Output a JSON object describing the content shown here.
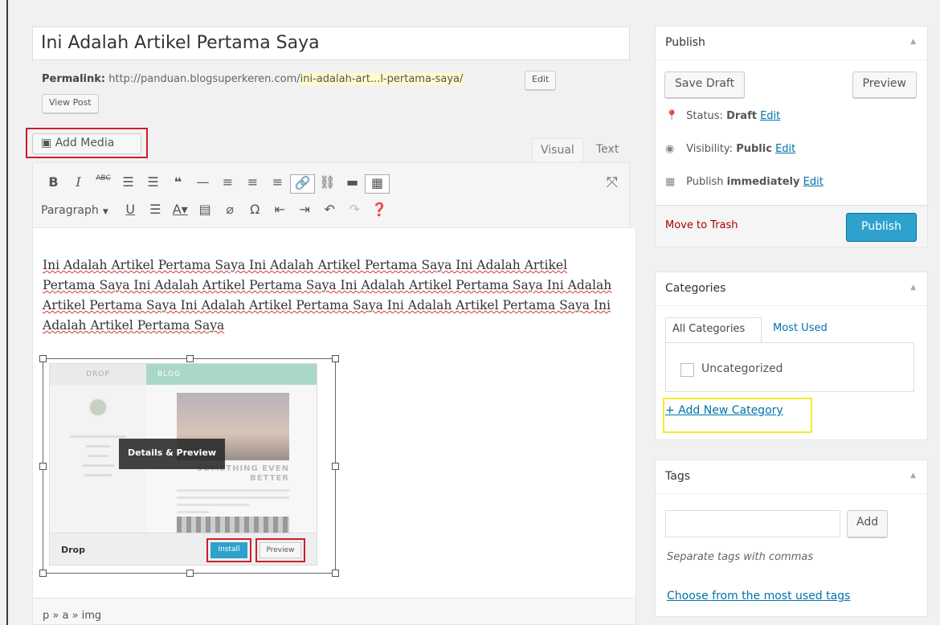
{
  "post": {
    "title": "Ini Adalah Artikel Pertama Saya",
    "permalink_label": "Permalink:",
    "permalink_base": "http://panduan.blogsuperkeren.com/",
    "permalink_slug": "ini-adalah-art...l-pertama-saya/",
    "edit_label": "Edit",
    "view_post_label": "View Post",
    "content": "Ini Adalah Artikel Pertama Saya Ini Adalah Artikel Pertama Saya Ini Adalah Artikel Pertama Saya Ini Adalah Artikel Pertama Saya Ini Adalah Artikel Pertama Saya Ini Adalah Artikel Pertama Saya Ini Adalah Artikel Pertama Saya Ini Adalah Artikel Pertama Saya Ini Adalah Artikel Pertama Saya"
  },
  "editor": {
    "add_media_label": "Add Media",
    "tab_visual": "Visual",
    "tab_text": "Text",
    "format_select": "Paragraph",
    "path": "p » a » img"
  },
  "embedded_image": {
    "header_left": "DROP",
    "header_right": "BLOG",
    "overlay": "Details & Preview",
    "headline": "SOMETHING EVEN BETTER",
    "theme_name": "Drop",
    "install": "Install",
    "preview": "Preview"
  },
  "publish_box": {
    "title": "Publish",
    "save_draft": "Save Draft",
    "preview": "Preview",
    "status_label": "Status:",
    "status_value": "Draft",
    "visibility_label": "Visibility:",
    "visibility_value": "Public",
    "publish_label": "Publish",
    "publish_value": "immediately",
    "edit": "Edit",
    "trash": "Move to Trash",
    "publish_button": "Publish"
  },
  "categories_box": {
    "title": "Categories",
    "tab_all": "All Categories",
    "tab_most_used": "Most Used",
    "items": [
      "Uncategorized"
    ],
    "add_new": "+ Add New Category"
  },
  "tags_box": {
    "title": "Tags",
    "add": "Add",
    "hint": "Separate tags with commas",
    "choose": "Choose from the most used tags"
  },
  "colors": {
    "accent": "#2ea2cc",
    "highlight_red": "#cc1f27",
    "highlight_yellow": "#f5ec2a",
    "link": "#0073aa"
  }
}
